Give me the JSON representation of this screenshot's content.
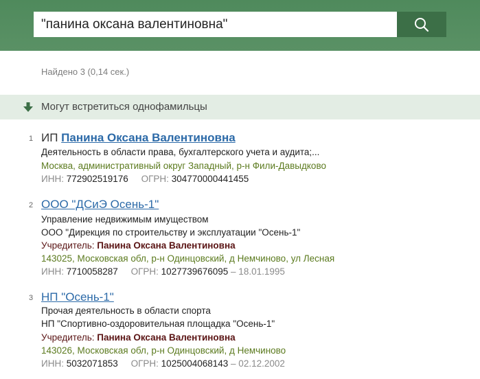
{
  "search": {
    "query": "\"панина оксана валентиновна\"",
    "button_icon": "search-icon"
  },
  "results_info": "Найдено 3 (0,14 сек.)",
  "banner": {
    "icon": "arrow-down-icon",
    "text": "Могут встретиться однофамильцы"
  },
  "colors": {
    "header_green": "#5a9165",
    "button_green": "#3c6f47",
    "link_blue": "#2c6aa8",
    "address_olive": "#5b7a1e",
    "founder_maroon": "#5a1414"
  },
  "results": [
    {
      "num": "1",
      "prefix": "ИП ",
      "title": "Панина Оксана Валентиновна",
      "activity": "Деятельность в области права, бухгалтерского учета и аудита;...",
      "address": "Москва, административный округ Западный, р-н Фили-Давыдково",
      "inn_label": "ИНН:",
      "inn": "772902519176",
      "ogrn_label": "ОГРН:",
      "ogrn": "304770000441455"
    },
    {
      "num": "2",
      "title": "ООО \"ДСиЭ Осень-1\"",
      "activity": "Управление недвижимым имуществом",
      "full_name": "ООО \"Дирекция по строительству и эксплуатации \"Осень-1\"",
      "founder_label": "Учредитель: ",
      "founder": "Панина Оксана Валентиновна",
      "address": "143025, Московская обл, р-н Одинцовский, д Немчиново, ул Лесная",
      "inn_label": "ИНН:",
      "inn": "7710058287",
      "ogrn_label": "ОГРН:",
      "ogrn": "1027739676095",
      "date": "– 18.01.1995"
    },
    {
      "num": "3",
      "title": "НП \"Осень-1\"",
      "activity": "Прочая деятельность в области спорта",
      "full_name": "НП \"Спортивно-оздоровительная площадка \"Осень-1\"",
      "founder_label": "Учредитель: ",
      "founder": "Панина Оксана Валентиновна",
      "address": "143026, Московская обл, р-н Одинцовский, д Немчиново",
      "inn_label": "ИНН:",
      "inn": "5032071853",
      "ogrn_label": "ОГРН:",
      "ogrn": "1025004068143",
      "date": "– 02.12.2002"
    }
  ]
}
